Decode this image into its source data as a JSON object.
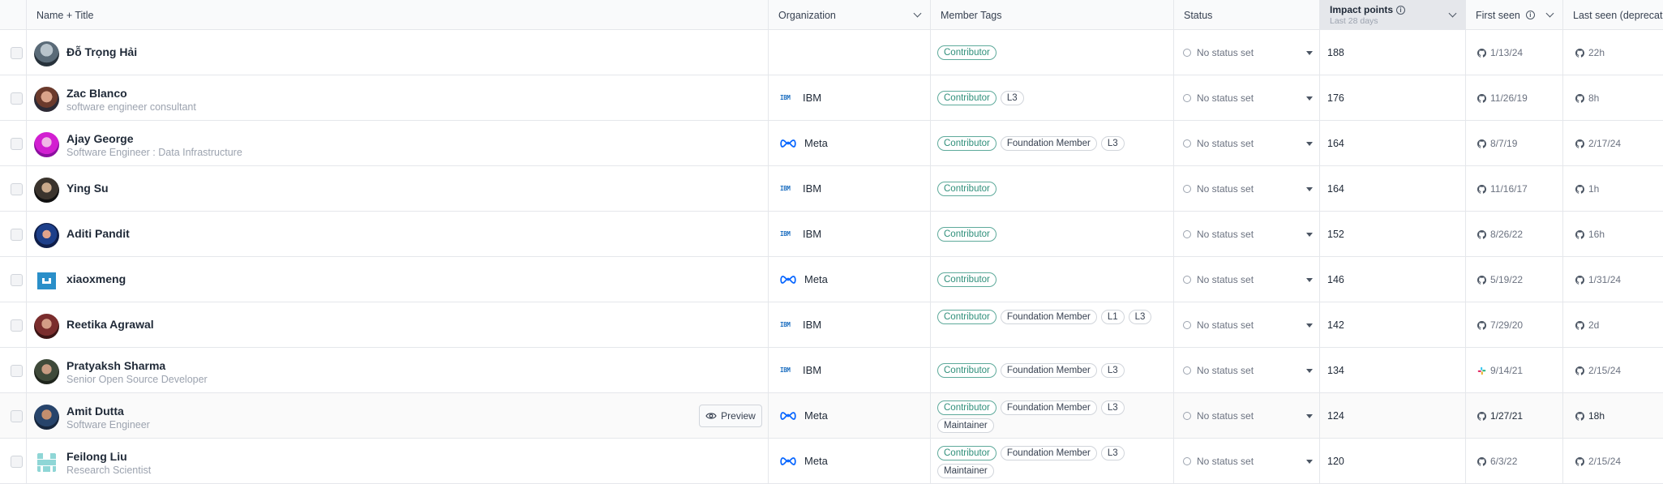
{
  "header": {
    "name_title": "Name + Title",
    "organization": "Organization",
    "member_tags": "Member Tags",
    "status": "Status",
    "impact_points": "Impact points",
    "impact_sub": "Last 28 days",
    "first_seen": "First seen",
    "last_seen": "Last seen (deprecate"
  },
  "preview_label": "Preview",
  "status_default": "No status set",
  "colors": {
    "contributor_tag": "#2f8f7a",
    "ibm_logo": "#1f70c1",
    "meta_logo": "#0866ff",
    "selected_header": "#e5e7eb"
  },
  "rows": [
    {
      "name": "Đỗ Trọng Hải",
      "title": "",
      "org": "",
      "tags": [
        "Contributor"
      ],
      "status": "No status set",
      "points": "188",
      "first": "1/13/24",
      "last": "22h",
      "first_icon": "github-icon",
      "last_icon": "github-icon"
    },
    {
      "name": "Zac Blanco",
      "title": "software engineer consultant",
      "org": "IBM",
      "tags": [
        "Contributor",
        "L3"
      ],
      "status": "No status set",
      "points": "176",
      "first": "11/26/19",
      "last": "8h",
      "first_icon": "github-icon",
      "last_icon": "github-icon"
    },
    {
      "name": "Ajay George",
      "title": "Software Engineer : Data Infrastructure",
      "org": "Meta",
      "tags": [
        "Contributor",
        "Foundation Member",
        "L3"
      ],
      "status": "No status set",
      "points": "164",
      "first": "8/7/19",
      "last": "2/17/24",
      "first_icon": "github-icon",
      "last_icon": "github-icon"
    },
    {
      "name": "Ying Su",
      "title": "",
      "org": "IBM",
      "tags": [
        "Contributor"
      ],
      "status": "No status set",
      "points": "164",
      "first": "11/16/17",
      "last": "1h",
      "first_icon": "github-icon",
      "last_icon": "github-icon"
    },
    {
      "name": "Aditi Pandit",
      "title": "",
      "org": "IBM",
      "tags": [
        "Contributor"
      ],
      "status": "No status set",
      "points": "152",
      "first": "8/26/22",
      "last": "16h",
      "first_icon": "github-icon",
      "last_icon": "github-icon"
    },
    {
      "name": "xiaoxmeng",
      "title": "",
      "org": "Meta",
      "tags": [
        "Contributor"
      ],
      "status": "No status set",
      "points": "146",
      "first": "5/19/22",
      "last": "1/31/24",
      "first_icon": "github-icon",
      "last_icon": "github-icon"
    },
    {
      "name": "Reetika Agrawal",
      "title": "",
      "org": "IBM",
      "tags": [
        "Contributor",
        "Foundation Member",
        "L1",
        "L3"
      ],
      "status": "No status set",
      "points": "142",
      "first": "7/29/20",
      "last": "2d",
      "first_icon": "github-icon",
      "last_icon": "github-icon"
    },
    {
      "name": "Pratyaksh Sharma",
      "title": "Senior Open Source Developer",
      "org": "IBM",
      "tags": [
        "Contributor",
        "Foundation Member",
        "L3"
      ],
      "status": "No status set",
      "points": "134",
      "first": "9/14/21",
      "last": "2/15/24",
      "first_icon": "slack-icon",
      "last_icon": "github-icon"
    },
    {
      "name": "Amit Dutta",
      "title": "Software Engineer",
      "org": "Meta",
      "tags": [
        "Contributor",
        "Foundation Member",
        "L3",
        "Maintainer"
      ],
      "status": "No status set",
      "points": "124",
      "first": "1/27/21",
      "last": "18h",
      "first_icon": "github-icon",
      "last_icon": "github-icon",
      "hover": true
    },
    {
      "name": "Feilong Liu",
      "title": "Research Scientist",
      "org": "Meta",
      "tags": [
        "Contributor",
        "Foundation Member",
        "L3",
        "Maintainer"
      ],
      "status": "No status set",
      "points": "120",
      "first": "6/3/22",
      "last": "2/15/24",
      "first_icon": "github-icon",
      "last_icon": "github-icon"
    }
  ]
}
